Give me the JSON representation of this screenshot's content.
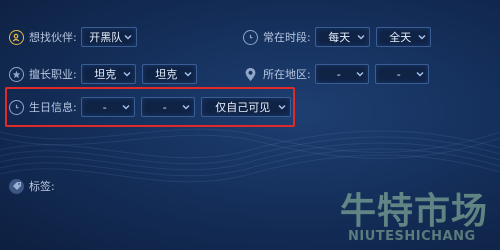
{
  "form": {
    "partner": {
      "label": "想找伙伴:",
      "value": "开黑队"
    },
    "online_time": {
      "label": "常在时段:",
      "day": "每天",
      "time": "全天"
    },
    "position": {
      "label": "擅长职业:",
      "first": "坦克",
      "second": "坦克"
    },
    "region": {
      "label": "所在地区:",
      "province": "-",
      "city": "-"
    },
    "birthday": {
      "label": "生日信息:",
      "month": "-",
      "day": "-",
      "visibility": "仅自己可见"
    },
    "tags": {
      "label": "标签:"
    }
  },
  "watermark": {
    "name_cn": "牛特市场",
    "name_en": "NIUTESHICHANG"
  },
  "colors": {
    "highlight": "#e02a2a",
    "icon_gold": "#e8b84a",
    "icon_blue": "#8fa6c8"
  }
}
